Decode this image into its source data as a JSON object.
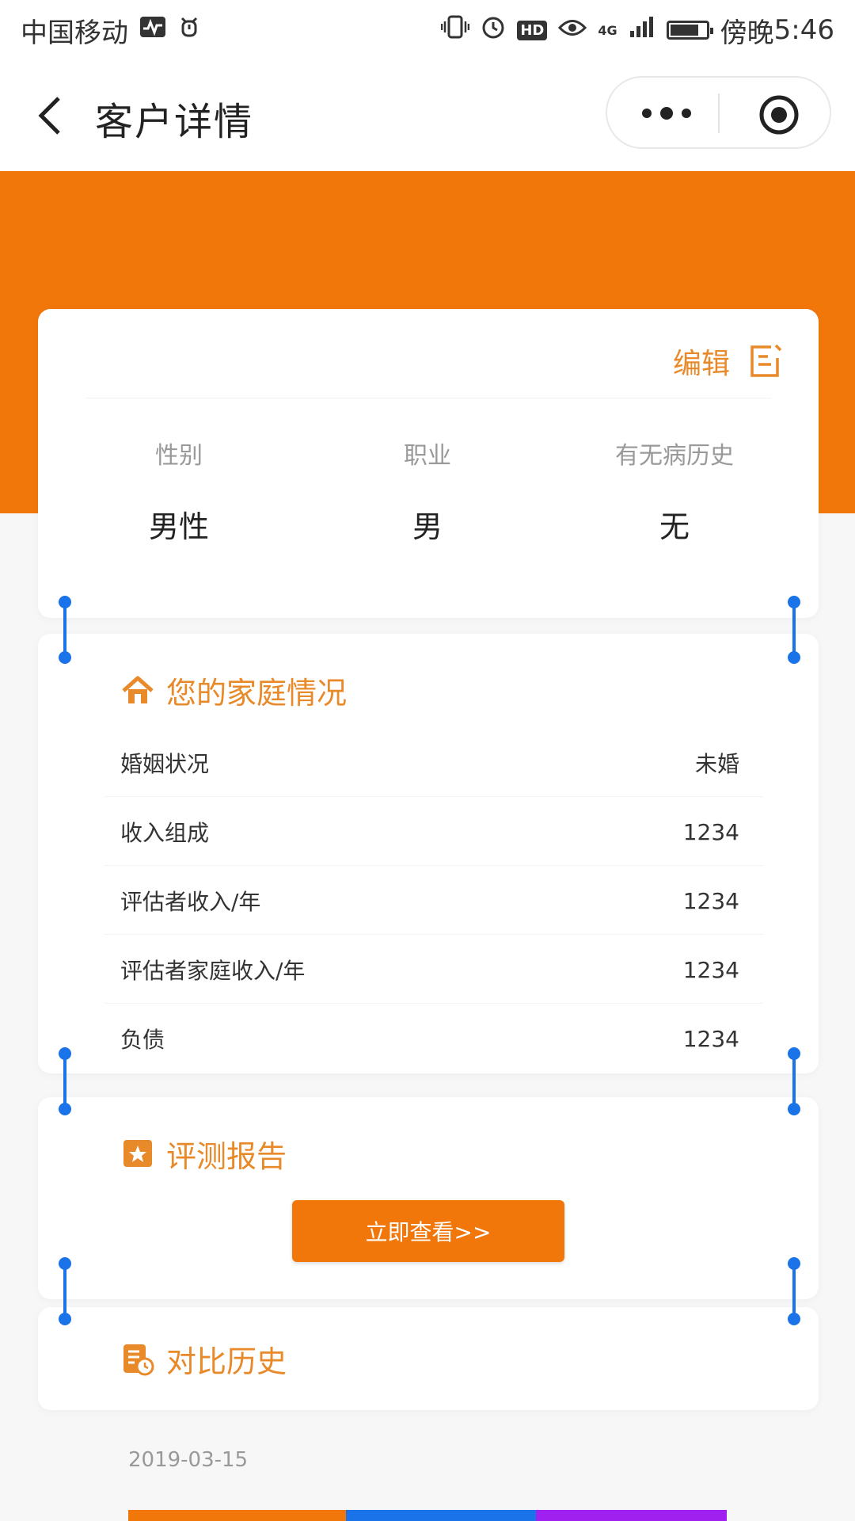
{
  "status_bar": {
    "carrier": "中国移动",
    "network": "4G",
    "hd_badge": "HD",
    "battery_level": 0.8,
    "time_prefix": "傍晚",
    "time": "5:46"
  },
  "header": {
    "title": "客户详情"
  },
  "profile": {
    "edit_label": "编辑",
    "attributes": [
      {
        "label": "性别",
        "value": "男性"
      },
      {
        "label": "职业",
        "value": "男"
      },
      {
        "label": "有无病历史",
        "value": "无"
      }
    ]
  },
  "family": {
    "title": "您的家庭情况",
    "rows": [
      {
        "label": "婚姻状况",
        "value": "未婚"
      },
      {
        "label": "收入组成",
        "value": "1234"
      },
      {
        "label": "评估者收入/年",
        "value": "1234"
      },
      {
        "label": "评估者家庭收入/年",
        "value": "1234"
      },
      {
        "label": "负债",
        "value": "1234"
      }
    ]
  },
  "report": {
    "title": "评测报告",
    "button_label": "立即查看>>"
  },
  "history": {
    "title": "对比历史",
    "date": "2019-03-15"
  },
  "colors": {
    "brand_orange": "#f1770b",
    "label_orange": "#e8892a",
    "handle_blue": "#1a73e8"
  }
}
